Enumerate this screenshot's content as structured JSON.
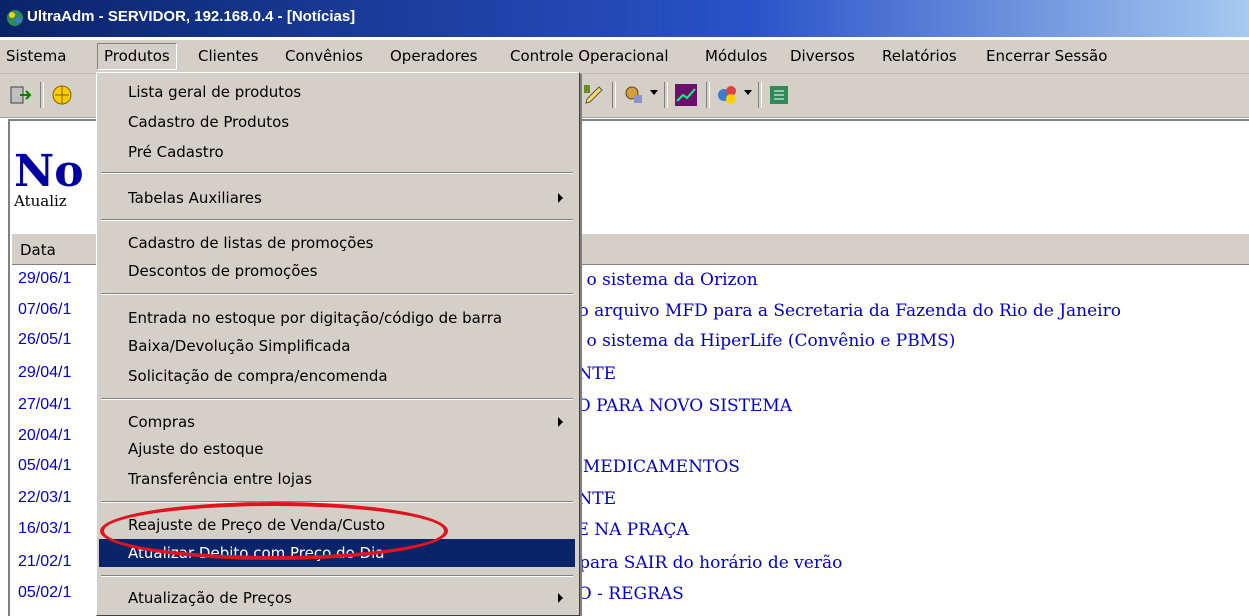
{
  "window": {
    "title": "UltraAdm - SERVIDOR, 192.168.0.4 - [Notícias]"
  },
  "menubar": {
    "items": [
      "Sistema",
      "Produtos",
      "Clientes",
      "Convênios",
      "Operadores",
      "Controle Operacional",
      "Módulos",
      "Diversos",
      "Relatórios",
      "Encerrar Sessão"
    ]
  },
  "page": {
    "title": "No",
    "subtitle": "Atualiz",
    "column_date": "Data"
  },
  "rows": [
    {
      "date": "29/06/1",
      "title": "m o sistema da Orizon"
    },
    {
      "date": "07/06/1",
      "title": "r o arquivo MFD para a Secretaria da Fazenda do Rio de Janeiro"
    },
    {
      "date": "26/05/1",
      "title": "m o sistema da HiperLife (Convênio e PBMS)"
    },
    {
      "date": "29/04/1",
      "title": "ENTE"
    },
    {
      "date": "27/04/1",
      "title": "ZO PARA NOVO SISTEMA"
    },
    {
      "date": "20/04/1",
      "title": ""
    },
    {
      "date": "05/04/1",
      "title": "E MEDICAMENTOS"
    },
    {
      "date": "22/03/1",
      "title": "ENTE"
    },
    {
      "date": "16/03/1",
      "title": "PE NA PRAÇA"
    },
    {
      "date": "21/02/1",
      "title": "s para SAIR do horário de verão"
    },
    {
      "date": "05/02/1",
      "title": "RO - REGRAS"
    }
  ],
  "dropdown": {
    "items": [
      "Lista geral de produtos",
      "Cadastro de Produtos",
      "Pré Cadastro",
      "Tabelas Auxiliares",
      "Cadastro de listas de promoções",
      "Descontos de promoções",
      "Entrada no estoque por digitação/código de barra",
      "Baixa/Devolução Simplificada",
      "Solicitação de compra/encomenda",
      "Compras",
      "Ajuste do estoque",
      "Transferência entre lojas",
      "Reajuste de Preço de Venda/Custo",
      "Atualizar Debito com Preço do Dia",
      "Atualização de Preços"
    ],
    "highlighted": "Atualizar Debito com Preço do Dia",
    "circled": "Reajuste de Preço de Venda/Custo"
  },
  "colors": {
    "title_bar": "#0a246a",
    "menu_bg": "#d4d0c8",
    "highlight": "#0a246a",
    "link": "#0000cc",
    "annotation": "#e0141e"
  }
}
